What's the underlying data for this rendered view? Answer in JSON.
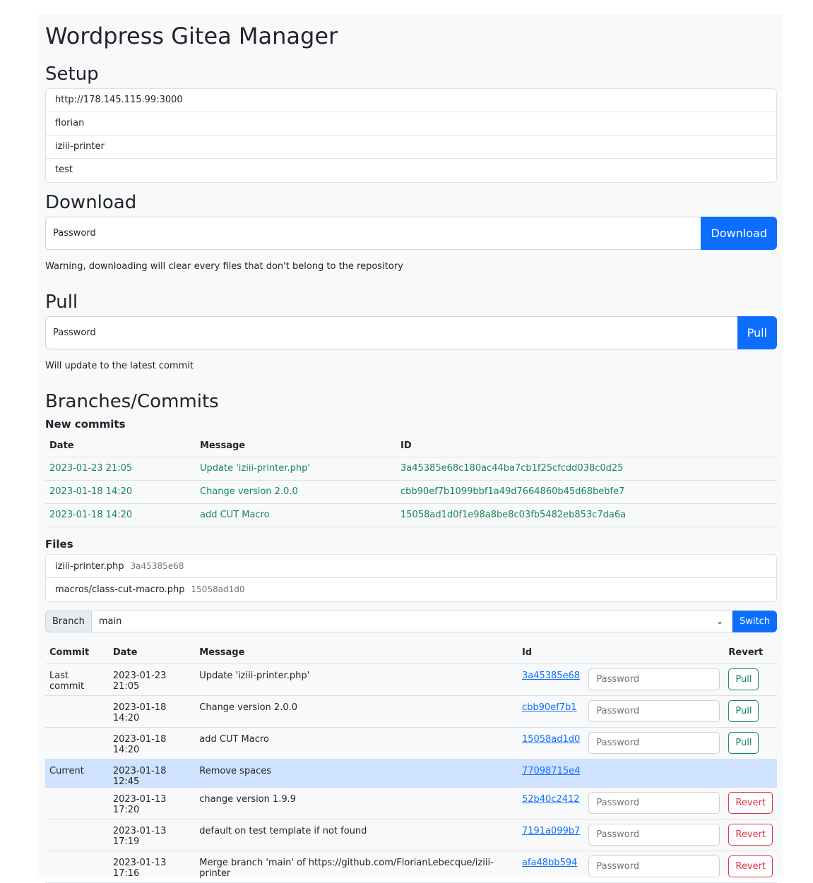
{
  "title": "Wordpress Gitea Manager",
  "setup": {
    "heading": "Setup",
    "items": [
      "http://178.145.115.99:3000",
      "florian",
      "iziii-printer",
      "test"
    ]
  },
  "download": {
    "heading": "Download",
    "placeholder": "Password",
    "button": "Download",
    "note": "Warning, downloading will clear every files that don't belong to the repository"
  },
  "pull": {
    "heading": "Pull",
    "placeholder": "Password",
    "button": "Pull",
    "note": "Will update to the latest commit"
  },
  "branches": {
    "heading": "Branches/Commits",
    "new_commits": {
      "heading": "New commits",
      "columns": [
        "Date",
        "Message",
        "ID"
      ],
      "rows": [
        {
          "date": "2023-01-23 21:05",
          "message": "Update 'iziii-printer.php'",
          "id": "3a45385e68c180ac44ba7cb1f25cfcdd038c0d25"
        },
        {
          "date": "2023-01-18 14:20",
          "message": "Change version 2.0.0",
          "id": "cbb90ef7b1099bbf1a49d7664860b45d68bebfe7"
        },
        {
          "date": "2023-01-18 14:20",
          "message": "add CUT Macro",
          "id": "15058ad1d0f1e98a8be8c03fb5482eb853c7da6a"
        }
      ]
    },
    "files": {
      "heading": "Files",
      "items": [
        {
          "name": "iziii-printer.php",
          "hash": "3a45385e68"
        },
        {
          "name": "macros/class-cut-macro.php",
          "hash": "15058ad1d0"
        }
      ]
    },
    "branch_label": "Branch",
    "branch_value": "main",
    "switch_button": "Switch",
    "commits": {
      "columns": [
        "Commit",
        "Date",
        "Message",
        "Id",
        "",
        "Revert"
      ],
      "password_placeholder": "Password",
      "rows": [
        {
          "commit": "Last commit",
          "date": "2023-01-23 21:05",
          "message": "Update 'iziii-printer.php'",
          "id": "3a45385e68",
          "action": "Pull"
        },
        {
          "commit": "",
          "date": "2023-01-18 14:20",
          "message": "Change version 2.0.0",
          "id": "cbb90ef7b1",
          "action": "Pull"
        },
        {
          "commit": "",
          "date": "2023-01-18 14:20",
          "message": "add CUT Macro",
          "id": "15058ad1d0",
          "action": "Pull"
        },
        {
          "commit": "Current",
          "date": "2023-01-18 12:45",
          "message": "Remove spaces",
          "id": "77098715e4",
          "action": ""
        },
        {
          "commit": "",
          "date": "2023-01-13 17:20",
          "message": "change version 1.9.9",
          "id": "52b40c2412",
          "action": "Revert"
        },
        {
          "commit": "",
          "date": "2023-01-13 17:19",
          "message": "default on test template if not found",
          "id": "7191a099b7",
          "action": "Revert"
        },
        {
          "commit": "",
          "date": "2023-01-13 17:16",
          "message": "Merge branch 'main' of https://github.com/FlorianLebecque/iziii-printer",
          "id": "afa48bb594",
          "action": "Revert"
        }
      ]
    }
  },
  "colors": {
    "primary": "#0d6efd",
    "success": "#198754",
    "danger": "#dc3545",
    "current_row": "#cfe2ff"
  }
}
